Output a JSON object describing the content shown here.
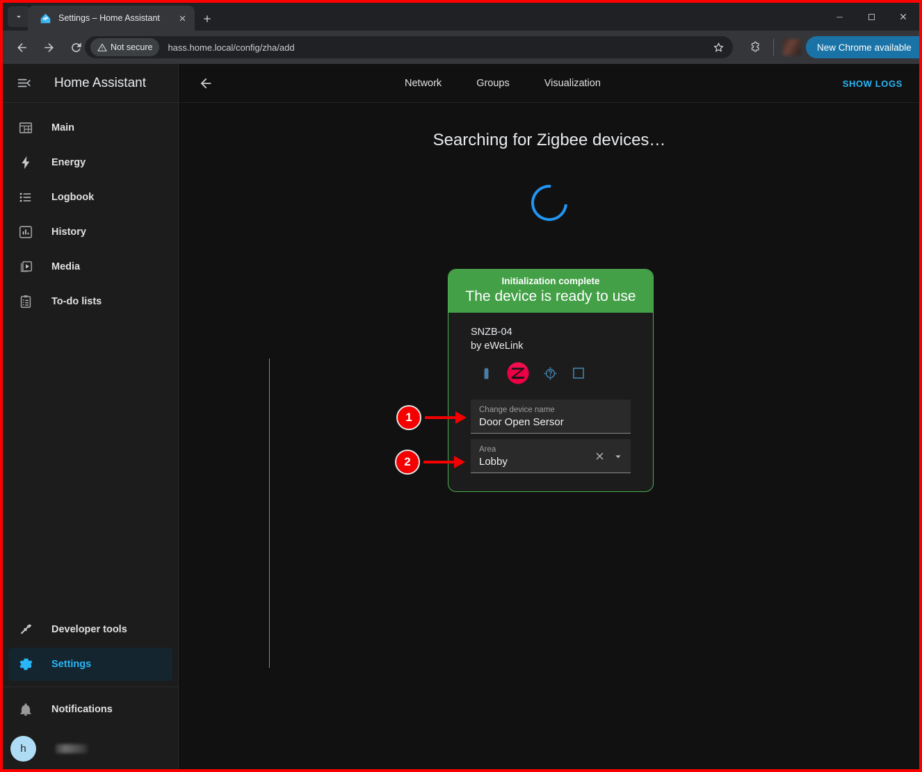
{
  "browser": {
    "tab": {
      "title": "Settings – Home Assistant",
      "favicon": "home-assistant-logo"
    },
    "new_tab_label": "+",
    "nav": {
      "back": "back-arrow",
      "forward": "forward-arrow",
      "reload": "reload-icon"
    },
    "security_label": "Not secure",
    "url": "hass.home.local/config/zha/add",
    "bookmark": "star-icon",
    "extensions": "puzzle-icon",
    "update_button": "New Chrome available",
    "menu": "three-dots-icon",
    "window_controls": {
      "minimize": "minimize-icon",
      "maximize": "maximize-icon",
      "close": "close-icon"
    }
  },
  "sidebar": {
    "title": "Home Assistant",
    "menu_icon": "menu-open-icon",
    "items": [
      {
        "label": "Main",
        "icon": "view-dashboard-icon",
        "active": false
      },
      {
        "label": "Energy",
        "icon": "lightning-bolt-icon",
        "active": false
      },
      {
        "label": "Logbook",
        "icon": "format-list-icon",
        "active": false
      },
      {
        "label": "History",
        "icon": "chart-box-icon",
        "active": false
      },
      {
        "label": "Media",
        "icon": "play-box-icon",
        "active": false
      },
      {
        "label": "To-do lists",
        "icon": "clipboard-list-icon",
        "active": false
      }
    ],
    "bottom_items": [
      {
        "label": "Developer tools",
        "icon": "hammer-icon",
        "active": false
      },
      {
        "label": "Settings",
        "icon": "gear-icon",
        "active": true
      }
    ],
    "notifications": {
      "label": "Notifications",
      "icon": "bell-icon"
    },
    "user": {
      "initial": "h",
      "name_redacted": ""
    }
  },
  "topbar": {
    "back_icon": "arrow-left-icon",
    "tabs": [
      {
        "label": "Network"
      },
      {
        "label": "Groups"
      },
      {
        "label": "Visualization"
      }
    ],
    "show_logs": "SHOW LOGS"
  },
  "main": {
    "heading": "Searching for Zigbee devices…",
    "spinner": "loading-spinner",
    "card": {
      "status_subtitle": "Initialization complete",
      "status_title": "The device is ready to use",
      "device_model": "SNZB-04",
      "device_manufacturer": "by eWeLink",
      "icons": [
        {
          "name": "battery-icon"
        },
        {
          "name": "zigbee-logo-icon"
        },
        {
          "name": "help-crosshair-icon"
        },
        {
          "name": "square-outline-icon"
        }
      ],
      "fields": [
        {
          "label": "Change device name",
          "value": "Door Open Sersor",
          "placeholder": "Change device name",
          "has_clear": false,
          "has_dropdown": false
        },
        {
          "label": "Area",
          "value": "Lobby",
          "placeholder": "Area",
          "has_clear": true,
          "has_dropdown": true
        }
      ]
    }
  },
  "annotations": [
    {
      "number": "1"
    },
    {
      "number": "2"
    }
  ],
  "colors": {
    "accent_blue": "#29b6f6",
    "success_green": "#43a047",
    "card_border_green": "#4caf50",
    "annotation_red": "#f50000",
    "chrome_button_blue": "#1a73a7"
  }
}
